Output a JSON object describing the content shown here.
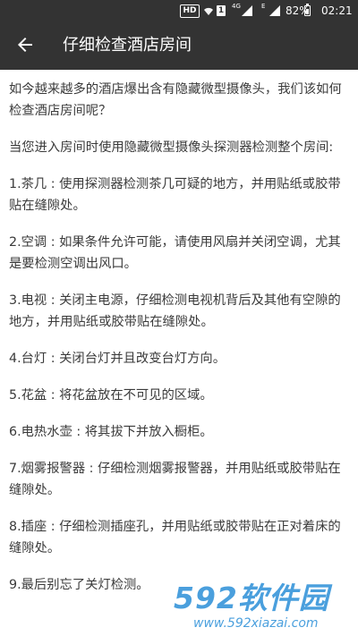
{
  "status_bar": {
    "hd": "HD",
    "sim": "1",
    "net_4g": "4G",
    "net_e": "E",
    "battery": "82%",
    "time": "02:21"
  },
  "app_bar": {
    "title": "仔细检查酒店房间"
  },
  "content": {
    "paragraphs": [
      "如今越来越多的酒店爆出含有隐藏微型摄像头，我们该如何检查酒店房间呢？",
      "当您进入房间时使用隐藏微型摄像头探测器检测整个房间:",
      "1.茶几 : 使用探测器检测茶几可疑的地方，并用贴纸或胶带贴在缝隙处。",
      "2.空调 : 如果条件允许可能，请使用风扇并关闭空调，尤其是要检测空调出风口。",
      "3.电视 : 关闭主电源，仔细检测电视机背后及其他有空隙的地方，并用贴纸或胶带贴在缝隙处。",
      "4.台灯 : 关闭台灯并且改变台灯方向。",
      "5.花盆 : 将花盆放在不可见的区域。",
      "6.电热水壶 : 将其拔下并放入橱柜。",
      "7.烟雾报警器 : 仔细检测烟雾报警器，并用贴纸或胶带贴在缝隙处。",
      "8.插座 : 仔细检测插座孔，并用贴纸或胶带贴在正对着床的缝隙处。",
      "9.最后别忘了关灯检测。"
    ]
  },
  "watermark": {
    "logo": "592软件园",
    "url": "www.592xiazai.com"
  },
  "colors": {
    "app_bar": "#333333",
    "text": "#3a3a3a",
    "watermark": "#2b8fd8",
    "background": "#ffffff"
  },
  "battery_level": 0.82
}
